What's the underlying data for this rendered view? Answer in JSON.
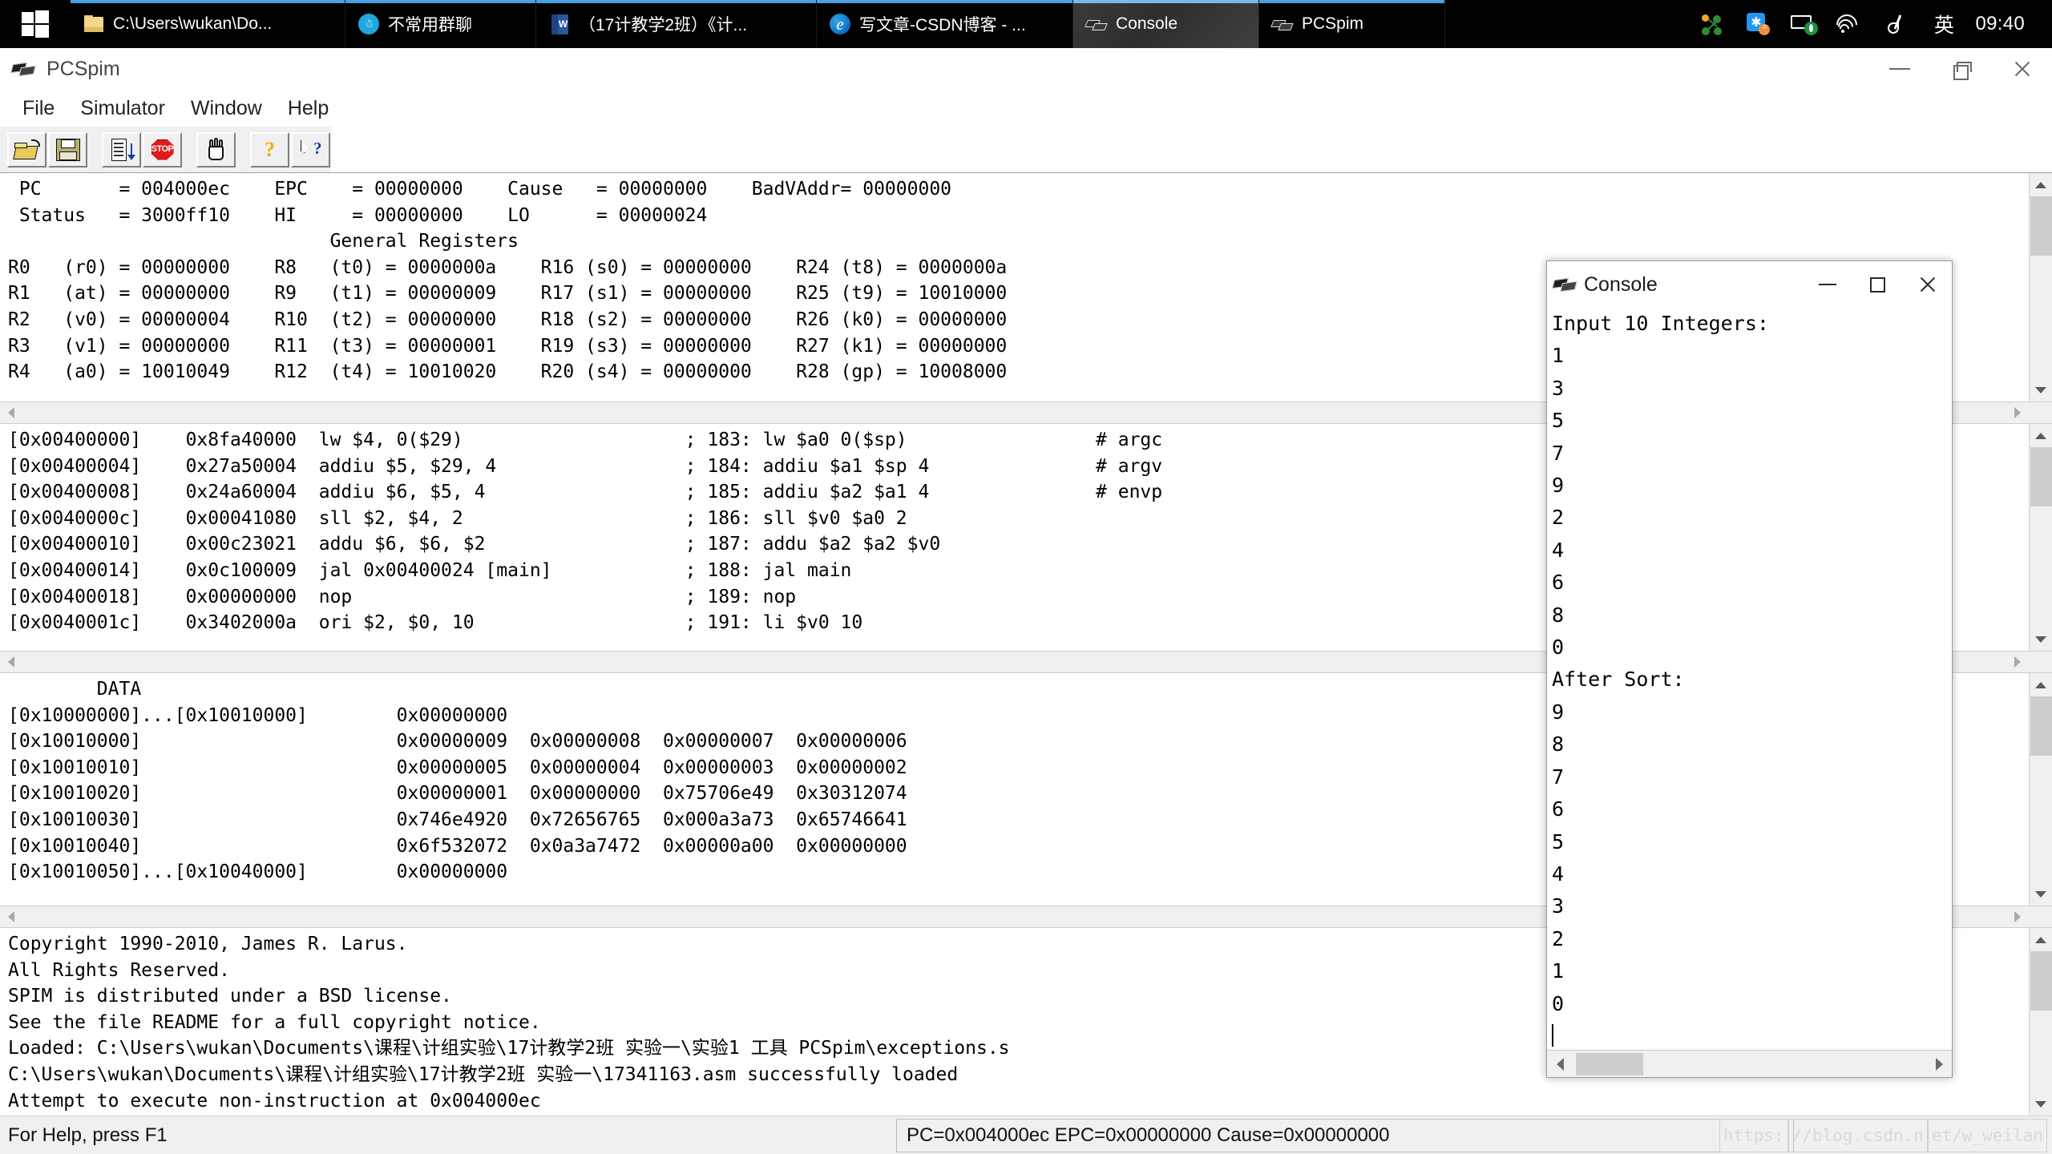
{
  "taskbar": {
    "start_icon": "windows-logo-icon",
    "items": [
      {
        "label": "C:\\Users\\wukan\\Do...",
        "icon": "folder-icon",
        "active": false
      },
      {
        "label": "不常用群聊",
        "icon": "qq-icon",
        "active": false
      },
      {
        "label": "（17计教学2班）《计...",
        "icon": "word-icon",
        "active": false
      },
      {
        "label": "写文章-CSDN博客 - ...",
        "icon": "edge-icon",
        "active": false
      },
      {
        "label": "Console",
        "icon": "spim-console-icon",
        "active": true
      },
      {
        "label": "PCSpim",
        "icon": "spim-console-icon",
        "active": false
      }
    ],
    "tray_icons": [
      "network-nodes-icon",
      "netease-music-icon",
      "screen-capture-icon",
      "wifi-icon",
      "pen-icon"
    ],
    "ime_label": "英",
    "clock": "09:40"
  },
  "window": {
    "title": "PCSpim",
    "app_icon": "pcspim-icon",
    "controls": {
      "minimize": "minimize",
      "maximize": "maximize",
      "close": "close"
    }
  },
  "menu": {
    "items": [
      "File",
      "Simulator",
      "Window",
      "Help"
    ]
  },
  "toolbar": {
    "buttons": [
      {
        "name": "open-file-button",
        "icon": "open-folder-icon"
      },
      {
        "name": "save-file-button",
        "icon": "floppy-disk-icon"
      },
      {
        "name": "run-step-button",
        "icon": "list-step-icon"
      },
      {
        "name": "stop-button",
        "icon": "stop-sign-icon",
        "glyph": "STOP"
      },
      {
        "name": "break-button",
        "icon": "hand-icon"
      },
      {
        "name": "help-button",
        "icon": "question-mark-icon",
        "glyph": "?"
      },
      {
        "name": "context-help-button",
        "icon": "arrow-question-icon",
        "glyph": "?"
      }
    ]
  },
  "registers_pane": {
    "lines": [
      " PC       = 004000ec    EPC    = 00000000    Cause   = 00000000    BadVAddr= 00000000",
      " Status   = 3000ff10    HI     = 00000000    LO      = 00000024",
      "                             General Registers",
      "R0   (r0) = 00000000    R8   (t0) = 0000000a    R16 (s0) = 00000000    R24 (t8) = 0000000a",
      "R1   (at) = 00000000    R9   (t1) = 00000009    R17 (s1) = 00000000    R25 (t9) = 10010000",
      "R2   (v0) = 00000004    R10  (t2) = 00000000    R18 (s2) = 00000000    R26 (k0) = 00000000",
      "R3   (v1) = 00000000    R11  (t3) = 00000001    R19 (s3) = 00000000    R27 (k1) = 00000000",
      "R4   (a0) = 10010049    R12  (t4) = 10010020    R20 (s4) = 00000000    R28 (gp) = 10008000"
    ]
  },
  "text_pane": {
    "lines": [
      "[0x00400000]\t0x8fa40000  lw $4, 0($29)                    ; 183: lw $a0 0($sp)                 # argc",
      "[0x00400004]\t0x27a50004  addiu $5, $29, 4                 ; 184: addiu $a1 $sp 4               # argv",
      "[0x00400008]\t0x24a60004  addiu $6, $5, 4                  ; 185: addiu $a2 $a1 4               # envp",
      "[0x0040000c]\t0x00041080  sll $2, $4, 2                    ; 186: sll $v0 $a0 2",
      "[0x00400010]\t0x00c23021  addu $6, $6, $2                  ; 187: addu $a2 $a2 $v0",
      "[0x00400014]\t0x0c100009  jal 0x00400024 [main]            ; 188: jal main",
      "[0x00400018]\t0x00000000  nop                              ; 189: nop",
      "[0x0040001c]\t0x3402000a  ori $2, $0, 10                   ; 191: li $v0 10"
    ]
  },
  "data_pane": {
    "lines": [
      "        DATA",
      "[0x10000000]...[0x10010000]        0x00000000",
      "[0x10010000]                       0x00000009  0x00000008  0x00000007  0x00000006",
      "[0x10010010]                       0x00000005  0x00000004  0x00000003  0x00000002",
      "[0x10010020]                       0x00000001  0x00000000  0x75706e49  0x30312074",
      "[0x10010030]                       0x746e4920  0x72656765  0x000a3a73  0x65746641",
      "[0x10010040]                       0x6f532072  0x0a3a7472  0x00000a00  0x00000000",
      "[0x10010050]...[0x10040000]        0x00000000"
    ]
  },
  "message_pane": {
    "lines": [
      "Copyright 1990-2010, James R. Larus.",
      "All Rights Reserved.",
      "SPIM is distributed under a BSD license.",
      "See the file README for a full copyright notice.",
      "Loaded: C:\\Users\\wukan\\Documents\\课程\\计组实验\\17计教学2班 实验一\\实验1 工具 PCSpim\\exceptions.s",
      "C:\\Users\\wukan\\Documents\\课程\\计组实验\\17计教学2班 实验一\\17341163.asm successfully loaded",
      "Attempt to execute non-instruction at 0x004000ec"
    ]
  },
  "console_window": {
    "title": "Console",
    "icon": "spim-console-icon",
    "controls": {
      "minimize": "minimize",
      "maximize": "maximize",
      "close": "close"
    },
    "output": "Input 10 Integers:\n1\n3\n5\n7\n9\n2\n4\n6\n8\n0\nAfter Sort:\n9\n8\n7\n6\n5\n4\n3\n2\n1\n0\n"
  },
  "statusbar": {
    "hint": "For Help, press F1",
    "registers": "PC=0x004000ec  EPC=0x00000000  Cause=0x00000000",
    "watermark": [
      "https:",
      "//blog.csdn.n",
      "et/w_weilan"
    ]
  },
  "colors": {
    "taskbar_bg": "#000000",
    "taskbar_active_highlight": "#76b9ec",
    "taskbar_inactive_highlight": "#4a9fe0",
    "window_chrome": "#f0f0f0",
    "pane_bg": "#ffffff",
    "text": "#000000",
    "scrollbar_thumb": "#cdcdcd"
  }
}
